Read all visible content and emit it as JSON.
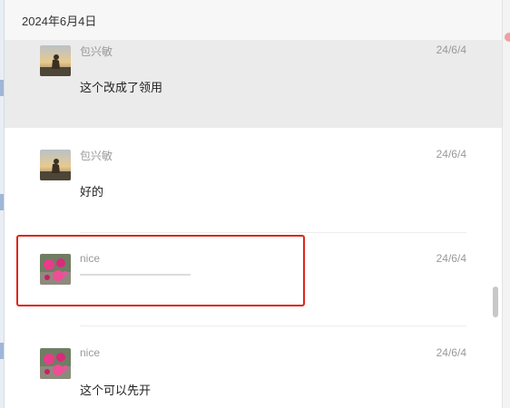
{
  "date_header": "2024年6月4日",
  "messages": [
    {
      "sender": "包兴敏",
      "time": "24/6/4",
      "text": "这个改成了领用",
      "avatar_icon": "sunset-person-avatar-icon",
      "highlighted": true
    },
    {
      "sender": "包兴敏",
      "time": "24/6/4",
      "text": "好的",
      "avatar_icon": "sunset-person-avatar-icon",
      "highlighted": false
    },
    {
      "sender": "nice",
      "time": "24/6/4",
      "text": "",
      "avatar_icon": "pink-flowers-avatar-icon",
      "highlighted": false,
      "annotated": true
    },
    {
      "sender": "nice",
      "time": "24/6/4",
      "text": "这个可以先开",
      "avatar_icon": "pink-flowers-avatar-icon",
      "highlighted": false
    }
  ],
  "colors": {
    "highlight_bg": "#ebebeb",
    "annotation_border": "#e0241a",
    "meta_text": "#999999"
  }
}
